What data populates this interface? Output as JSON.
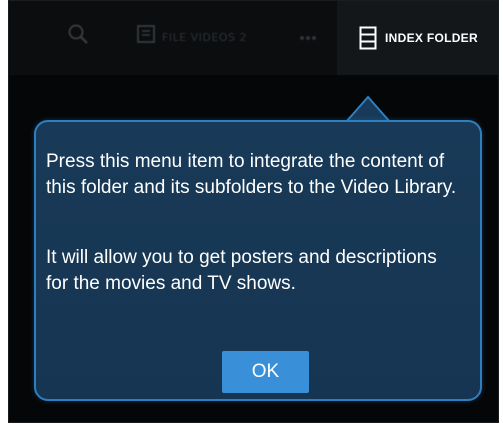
{
  "actionbar": {
    "filter_label": "FILE VIDEOS 2",
    "index_folder_label": "INDEX FOLDER"
  },
  "dialog": {
    "paragraph_1": "Press this menu item to integrate the content of this folder and its subfolders to the Video Library.",
    "paragraph_2": "It will allow you to get posters and descriptions for the movies and TV shows.",
    "ok_label": "OK"
  },
  "icons": {
    "search": "search-icon",
    "filter": "filter-icon",
    "overflow": "overflow-dots-icon",
    "index_folder": "film-strip-icon"
  },
  "colors": {
    "dialog_background": "#173754",
    "dialog_border": "#2e7fc0",
    "ok_button": "#3a90d8",
    "screen_background": "#050607"
  }
}
